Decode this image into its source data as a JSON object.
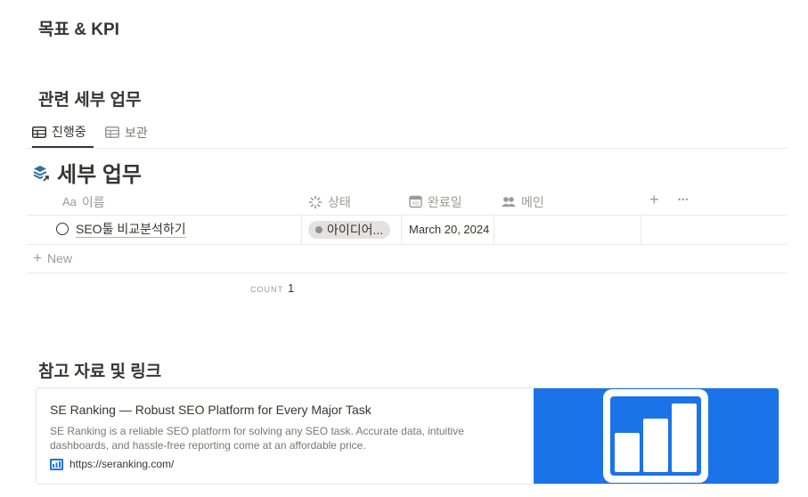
{
  "headings": {
    "goals_kpi": "목표 & KPI",
    "related_tasks": "관련 세부 업무",
    "references": "참고 자료 및 링크"
  },
  "tabs": [
    {
      "label": "진행중",
      "icon": "table-icon",
      "active": true
    },
    {
      "label": "보관",
      "icon": "table-icon",
      "active": false
    }
  ],
  "database": {
    "title": "세부 업무",
    "icon": "stack-arrow-icon",
    "columns": [
      {
        "label": "이름",
        "icon_text": "Aa"
      },
      {
        "label": "상태",
        "icon": "status-spinner-icon"
      },
      {
        "label": "완료일",
        "icon": "calendar-icon"
      },
      {
        "label": "메인",
        "icon": "people-icon"
      }
    ],
    "add_column": "+",
    "more": "•••",
    "rows": [
      {
        "name": "SEO툴 비교분석하기",
        "status": "아이디어...",
        "due_date": "March 20, 2024",
        "main": ""
      }
    ],
    "new_label": "New",
    "count_label": "COUNT",
    "count_value": "1"
  },
  "bookmark": {
    "title": "SE Ranking — Robust SEO Platform for Every Major Task",
    "description": "SE Ranking is a reliable SEO platform for solving any SEO task. Accurate data, intuitive dashboards, and hassle-free reporting come at an affordable price.",
    "url": "https://seranking.com/",
    "image_bg": "#1a73e8"
  },
  "colors": {
    "text": "#37352f",
    "muted": "#9b9a97",
    "divider": "#e9e9e7",
    "pill": "#e3e2e0"
  }
}
